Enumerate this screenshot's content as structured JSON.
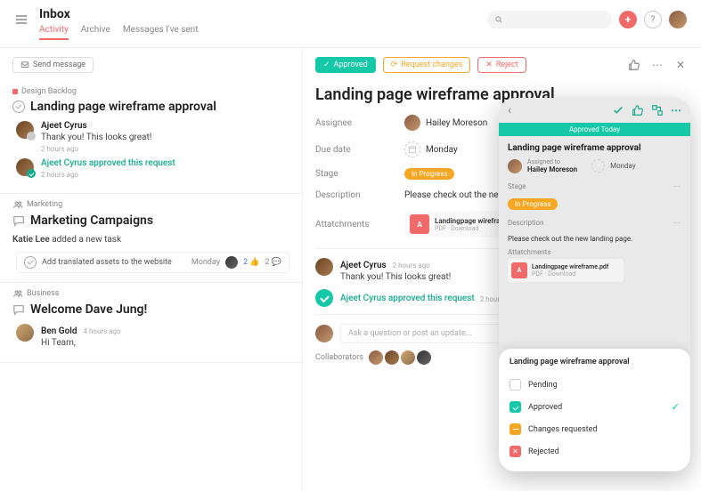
{
  "header": {
    "title": "Inbox",
    "tabs": [
      "Activity",
      "Archive",
      "Messages I've sent"
    ],
    "send_message": "Send message"
  },
  "left": {
    "backlog": {
      "label": "Design Backlog",
      "title": "Landing page wireframe approval",
      "c1_name": "Ajeet Cyrus",
      "c1_text": "Thank you! This looks great!",
      "c1_time": "2 hours ago",
      "c2_text": "Ajeet Cyrus approved this request",
      "c2_time": "2 hours ago"
    },
    "marketing": {
      "label": "Marketing",
      "title": "Marketing Campaigns",
      "meta_name": "Katie Lee",
      "meta_action": "added a new task",
      "task": "Add translated assets to the website",
      "task_day": "Monday",
      "task_likes": "2",
      "task_comments": "2"
    },
    "business": {
      "label": "Business",
      "title": "Welcome Dave Jung!",
      "c_name": "Ben Gold",
      "c_time": "4 hours ago",
      "c_text": "Hi Team,"
    }
  },
  "detail": {
    "buttons": {
      "approved": "Approved",
      "request": "Request changes",
      "reject": "Reject"
    },
    "title": "Landing page wireframe approval",
    "fields": {
      "assignee_label": "Assignee",
      "assignee": "Hailey Moreson",
      "due_label": "Due date",
      "due": "Monday",
      "stage_label": "Stage",
      "stage": "In Progress",
      "desc_label": "Description",
      "desc": "Please check out the new landing page.",
      "att_label": "Attatchments",
      "att_file": "Landingpage wireframe.pdf",
      "att_sub": "PDF · Download"
    },
    "c1_name": "Ajeet Cyrus",
    "c1_time": "2 hours ago",
    "c1_text": "Thank you! This looks great!",
    "c2_text": "Ajeet Cyrus approved this request",
    "c2_time": "2 hours ago",
    "ask": "Ask a question or post an update...",
    "collab_label": "Collaborators"
  },
  "mobile": {
    "banner": "Approved Today",
    "title": "Landing page wireframe approval",
    "assigned_label": "Assigned to",
    "assignee": "Hailey Moreson",
    "due": "Monday",
    "stage_label": "Stage",
    "stage": "In Progress",
    "desc_label": "Description",
    "desc": "Please check out the new landing page.",
    "att_label": "Attatchments",
    "att_file": "Landingpage wireframe.pdf",
    "att_sub": "PDF · Download",
    "sheet_title": "Landing page wireframe approval",
    "opts": {
      "pending": "Pending",
      "approved": "Approved",
      "changes": "Changes requested",
      "rejected": "Rejected"
    }
  }
}
